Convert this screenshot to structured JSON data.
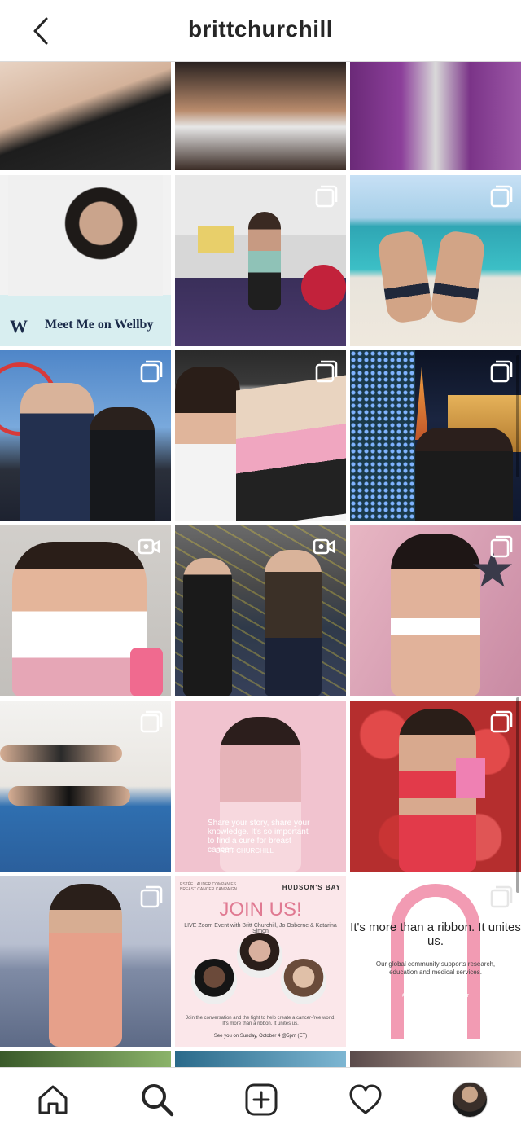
{
  "header": {
    "username": "brittchurchill"
  },
  "posts": [
    {
      "id": "p1",
      "alt": "post",
      "type": "image"
    },
    {
      "id": "p2",
      "alt": "post",
      "type": "image"
    },
    {
      "id": "p3",
      "alt": "post",
      "type": "image"
    },
    {
      "id": "p4",
      "alt": "post",
      "type": "image",
      "text": "Meet Me on Wellby",
      "logo": "W"
    },
    {
      "id": "p5",
      "alt": "post",
      "type": "carousel"
    },
    {
      "id": "p6",
      "alt": "post",
      "type": "carousel"
    },
    {
      "id": "p7",
      "alt": "post",
      "type": "carousel"
    },
    {
      "id": "p8",
      "alt": "post",
      "type": "carousel"
    },
    {
      "id": "p9",
      "alt": "post",
      "type": "carousel"
    },
    {
      "id": "p10",
      "alt": "post",
      "type": "video"
    },
    {
      "id": "p11",
      "alt": "post",
      "type": "video"
    },
    {
      "id": "p12",
      "alt": "post",
      "type": "carousel"
    },
    {
      "id": "p13",
      "alt": "post",
      "type": "carousel"
    },
    {
      "id": "p14",
      "alt": "post",
      "type": "image",
      "quote": "Share your story, share your knowledge. It's so important to find a cure for breast cancer.",
      "sign": "BRITT CHURCHILL"
    },
    {
      "id": "p15",
      "alt": "post",
      "type": "carousel"
    },
    {
      "id": "p16",
      "alt": "post",
      "type": "carousel"
    },
    {
      "id": "p17",
      "alt": "post",
      "type": "image",
      "brand_left": "ESTÉE LAUDER COMPANIES BREAST CANCER CAMPAIGN",
      "brand_right": "HUDSON'S BAY",
      "headline": "JOIN US!",
      "subline": "LIVE Zoom Event with Britt Churchill, Jo Osborne & Katarina Simon",
      "footer": "Join the conversation and the fight to help create a cancer-free world. It's more than a ribbon. It unites us.",
      "date_line": "See you on Sunday, October 4 @5pm (ET)"
    },
    {
      "id": "p18",
      "alt": "post",
      "type": "carousel",
      "headline": "It's more than a ribbon. It unites us.",
      "body": "Our global community supports research, education and medical services.",
      "hashtag": "#TimeToEndBreastCancer"
    }
  ],
  "nav": {
    "items": [
      {
        "name": "home",
        "label": "Home"
      },
      {
        "name": "search",
        "label": "Search"
      },
      {
        "name": "new-post",
        "label": "New Post"
      },
      {
        "name": "activity",
        "label": "Activity"
      },
      {
        "name": "profile",
        "label": "Profile"
      }
    ]
  },
  "colors": {
    "header_text": "#262626",
    "border": "#dbdbdb",
    "pink": "#f3c6d3",
    "ribbon": "#f29bb3"
  }
}
